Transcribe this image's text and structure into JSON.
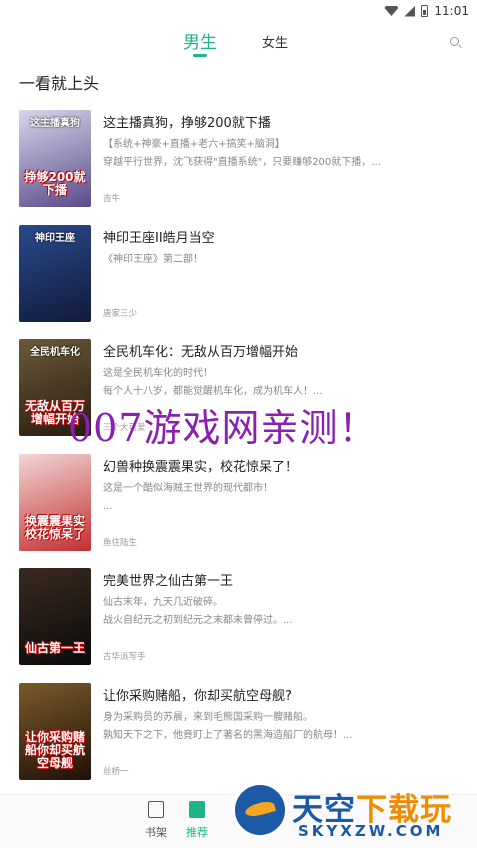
{
  "status_bar": {
    "time": "11:01"
  },
  "tabs": [
    {
      "label": "男生",
      "active": true
    },
    {
      "label": "女生",
      "active": false
    }
  ],
  "section_title": "一看就上头",
  "books": [
    {
      "title": "这主播真狗，挣够200就下播",
      "desc": [
        "【系统+神豪+直播+老六+搞笑+脑洞】",
        "穿越平行世界，沈飞获得\"直播系统\"，只要赚够200就下播，..."
      ],
      "author": "吉牛",
      "cover_text": "挣够200就下播",
      "cover_top": "这主播真狗",
      "cover_colors": [
        "#d8d6ea",
        "#5a4a8a"
      ]
    },
    {
      "title": "神印王座II皓月当空",
      "desc": [
        "《神印王座》第二部！",
        ""
      ],
      "author": "唐家三少",
      "cover_text": "",
      "cover_top": "神印王座",
      "cover_colors": [
        "#2a4a8c",
        "#111a3a"
      ]
    },
    {
      "title": "全民机车化：无敌从百万增幅开始",
      "desc": [
        "这是全民机车化的时代！",
        "每个人十八岁，都能觉醒机车化，成为机车人！..."
      ],
      "author": "三个大可爱",
      "cover_text": "无敌从百万增幅开始",
      "cover_top": "全民机车化",
      "cover_colors": [
        "#6a5a3a",
        "#2a1a10"
      ]
    },
    {
      "title": "幻兽种换震震果实，校花惊呆了！",
      "desc": [
        "这是一个酷似海贼王世界的现代都市！",
        "..."
      ],
      "author": "鱼住陆生",
      "cover_text": "换震震果实校花惊呆了",
      "cover_top": "",
      "cover_colors": [
        "#f3d6d6",
        "#c03030"
      ]
    },
    {
      "title": "完美世界之仙古第一王",
      "desc": [
        "仙古末年，九天几近破碎。",
        "战火自纪元之初到纪元之末都未曾停过。..."
      ],
      "author": "古华派写手",
      "cover_text": "仙古第一王",
      "cover_top": "",
      "cover_colors": [
        "#3a2a20",
        "#0a0a0a"
      ]
    },
    {
      "title": "让你采购赌船，你却买航空母舰?",
      "desc": [
        "身为采购员的苏晨，来到毛熊国采购一艘赌船。",
        "孰知天下之下，他竟盯上了著名的黑海造船厂的航母！..."
      ],
      "author": "丝桥一",
      "cover_text": "让你采购赌船你却买航空母舰",
      "cover_top": "",
      "cover_colors": [
        "#7a5a2a",
        "#201008"
      ]
    }
  ],
  "watermark": "007游戏网亲测！",
  "bottom_nav": [
    {
      "label": "书架",
      "active": false
    },
    {
      "label": "推荐",
      "active": true
    }
  ],
  "logo": {
    "main": "天空",
    "accent": "下载玩",
    "sub": "SKYXZW.COM"
  },
  "colors": {
    "accent": "#1fb486",
    "watermark": "#8a1fb0",
    "logo_blue": "#1c5aa5",
    "logo_orange": "#f08c00"
  }
}
